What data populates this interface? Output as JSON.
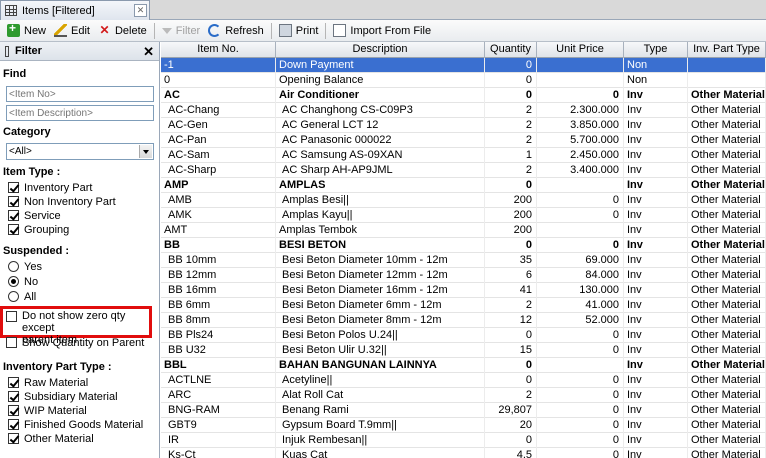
{
  "tab": {
    "title": "Items [Filtered]"
  },
  "toolbar": {
    "new": "New",
    "edit": "Edit",
    "delete": "Delete",
    "filter": "Filter",
    "refresh": "Refresh",
    "print": "Print",
    "import": "Import From File"
  },
  "filter": {
    "title": "Filter",
    "find_label": "Find",
    "item_no_placeholder": "<Item No>",
    "item_desc_placeholder": "<Item Description>",
    "category_label": "Category",
    "category_value": "<All>",
    "item_type_label": "Item Type :",
    "item_types": [
      {
        "label": "Inventory Part",
        "checked": true
      },
      {
        "label": "Non Inventory Part",
        "checked": true
      },
      {
        "label": "Service",
        "checked": true
      },
      {
        "label": "Grouping",
        "checked": true
      }
    ],
    "suspended_label": "Suspended :",
    "suspended_options": [
      {
        "label": "Yes",
        "checked": false
      },
      {
        "label": "No",
        "checked": true
      },
      {
        "label": "All",
        "checked": false
      }
    ],
    "zero_qty_line1": "Do not show zero qty except",
    "zero_qty_line2": "parent item",
    "show_qty_parent": "Show Quantity on Parent",
    "inv_part_type_label": "Inventory Part Type :",
    "inv_part_types": [
      {
        "label": "Raw Material",
        "checked": true
      },
      {
        "label": "Subsidiary Material",
        "checked": true
      },
      {
        "label": "WIP Material",
        "checked": true
      },
      {
        "label": "Finished Goods Material",
        "checked": true
      },
      {
        "label": "Other Material",
        "checked": true
      }
    ]
  },
  "grid": {
    "columns": [
      "Item No.",
      "Description",
      "Quantity",
      "Unit Price",
      "Type",
      "Inv. Part Type"
    ],
    "rows": [
      {
        "item": "-1",
        "desc": "Down Payment",
        "qty": "0",
        "price": "",
        "type": "Non",
        "ipt": "",
        "group": false,
        "selected": true,
        "sub": false
      },
      {
        "item": "0",
        "desc": "Opening Balance",
        "qty": "0",
        "price": "",
        "type": "Non",
        "ipt": "",
        "group": false,
        "selected": false,
        "sub": false
      },
      {
        "item": "AC",
        "desc": "Air Conditioner",
        "qty": "0",
        "price": "0",
        "type": "Inv",
        "ipt": "Other Material",
        "group": true,
        "selected": false,
        "sub": false
      },
      {
        "item": "AC-Chang",
        "desc": "AC Changhong CS-C09P3",
        "qty": "2",
        "price": "2.300.000",
        "type": "Inv",
        "ipt": "Other Material",
        "group": false,
        "selected": false,
        "sub": true
      },
      {
        "item": "AC-Gen",
        "desc": "AC General LCT 12",
        "qty": "2",
        "price": "3.850.000",
        "type": "Inv",
        "ipt": "Other Material",
        "group": false,
        "selected": false,
        "sub": true
      },
      {
        "item": "AC-Pan",
        "desc": "AC Panasonic 000022",
        "qty": "2",
        "price": "5.700.000",
        "type": "Inv",
        "ipt": "Other Material",
        "group": false,
        "selected": false,
        "sub": true
      },
      {
        "item": "AC-Sam",
        "desc": "AC Samsung AS-09XAN",
        "qty": "1",
        "price": "2.450.000",
        "type": "Inv",
        "ipt": "Other Material",
        "group": false,
        "selected": false,
        "sub": true
      },
      {
        "item": "AC-Sharp",
        "desc": "AC Sharp AH-AP9JML",
        "qty": "2",
        "price": "3.400.000",
        "type": "Inv",
        "ipt": "Other Material",
        "group": false,
        "selected": false,
        "sub": true
      },
      {
        "item": "AMP",
        "desc": "AMPLAS",
        "qty": "0",
        "price": "",
        "type": "Inv",
        "ipt": "Other Material",
        "group": true,
        "selected": false,
        "sub": false
      },
      {
        "item": "AMB",
        "desc": "Amplas Besi||",
        "qty": "200",
        "price": "0",
        "type": "Inv",
        "ipt": "Other Material",
        "group": false,
        "selected": false,
        "sub": true
      },
      {
        "item": "AMK",
        "desc": "Amplas Kayu||",
        "qty": "200",
        "price": "0",
        "type": "Inv",
        "ipt": "Other Material",
        "group": false,
        "selected": false,
        "sub": true
      },
      {
        "item": "AMT",
        "desc": "Amplas Tembok",
        "qty": "200",
        "price": "",
        "type": "Inv",
        "ipt": "Other Material",
        "group": false,
        "selected": false,
        "sub": false
      },
      {
        "item": "BB",
        "desc": "BESI BETON",
        "qty": "0",
        "price": "0",
        "type": "Inv",
        "ipt": "Other Material",
        "group": true,
        "selected": false,
        "sub": false
      },
      {
        "item": "BB 10mm",
        "desc": "Besi Beton Diameter 10mm - 12m",
        "qty": "35",
        "price": "69.000",
        "type": "Inv",
        "ipt": "Other Material",
        "group": false,
        "selected": false,
        "sub": true
      },
      {
        "item": "BB 12mm",
        "desc": "Besi Beton Diameter 12mm - 12m",
        "qty": "6",
        "price": "84.000",
        "type": "Inv",
        "ipt": "Other Material",
        "group": false,
        "selected": false,
        "sub": true
      },
      {
        "item": "BB 16mm",
        "desc": "Besi Beton Diameter 16mm - 12m",
        "qty": "41",
        "price": "130.000",
        "type": "Inv",
        "ipt": "Other Material",
        "group": false,
        "selected": false,
        "sub": true
      },
      {
        "item": "BB 6mm",
        "desc": "Besi Beton Diameter 6mm - 12m",
        "qty": "2",
        "price": "41.000",
        "type": "Inv",
        "ipt": "Other Material",
        "group": false,
        "selected": false,
        "sub": true
      },
      {
        "item": "BB 8mm",
        "desc": "Besi Beton Diameter 8mm - 12m",
        "qty": "12",
        "price": "52.000",
        "type": "Inv",
        "ipt": "Other Material",
        "group": false,
        "selected": false,
        "sub": true
      },
      {
        "item": "BB Pls24",
        "desc": "Besi Beton Polos U.24||",
        "qty": "0",
        "price": "0",
        "type": "Inv",
        "ipt": "Other Material",
        "group": false,
        "selected": false,
        "sub": true
      },
      {
        "item": "BB U32",
        "desc": "Besi Beton Ulir U.32||",
        "qty": "15",
        "price": "0",
        "type": "Inv",
        "ipt": "Other Material",
        "group": false,
        "selected": false,
        "sub": true
      },
      {
        "item": "BBL",
        "desc": "BAHAN BANGUNAN LAINNYA",
        "qty": "0",
        "price": "",
        "type": "Inv",
        "ipt": "Other Material",
        "group": true,
        "selected": false,
        "sub": false
      },
      {
        "item": "ACTLNE",
        "desc": "Acetyline||",
        "qty": "0",
        "price": "0",
        "type": "Inv",
        "ipt": "Other Material",
        "group": false,
        "selected": false,
        "sub": true
      },
      {
        "item": "ARC",
        "desc": "Alat Roll Cat",
        "qty": "2",
        "price": "0",
        "type": "Inv",
        "ipt": "Other Material",
        "group": false,
        "selected": false,
        "sub": true
      },
      {
        "item": "BNG-RAM",
        "desc": "Benang Rami",
        "qty": "29,807",
        "price": "0",
        "type": "Inv",
        "ipt": "Other Material",
        "group": false,
        "selected": false,
        "sub": true
      },
      {
        "item": "GBT9",
        "desc": "Gypsum Board T.9mm||",
        "qty": "20",
        "price": "0",
        "type": "Inv",
        "ipt": "Other Material",
        "group": false,
        "selected": false,
        "sub": true
      },
      {
        "item": "IR",
        "desc": "Injuk Rembesan||",
        "qty": "0",
        "price": "0",
        "type": "Inv",
        "ipt": "Other Material",
        "group": false,
        "selected": false,
        "sub": true
      },
      {
        "item": "Ks-Ct",
        "desc": "Kuas Cat",
        "qty": "4,5",
        "price": "0",
        "type": "Inv",
        "ipt": "Other Material",
        "group": false,
        "selected": false,
        "sub": true
      }
    ]
  }
}
